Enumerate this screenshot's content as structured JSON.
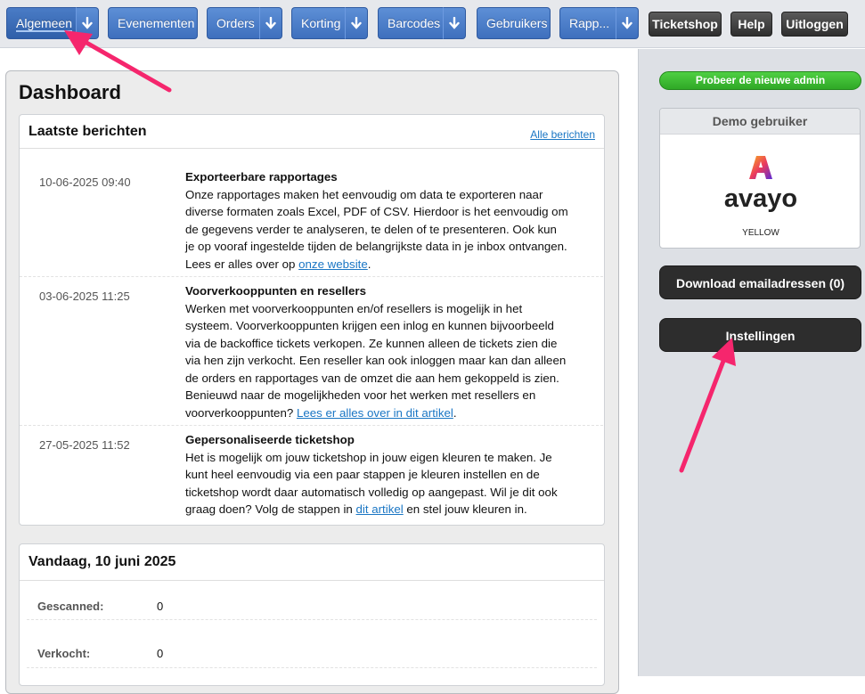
{
  "nav": {
    "items": [
      {
        "label": "Algemeen"
      },
      {
        "label": "Evenementen"
      },
      {
        "label": "Orders"
      },
      {
        "label": "Korting"
      },
      {
        "label": "Barcodes"
      },
      {
        "label": "Gebruikers"
      },
      {
        "label": "Rapp..."
      }
    ],
    "ticketshop": "Ticketshop",
    "help": "Help",
    "logout": "Uitloggen"
  },
  "dashboard": {
    "title": "Dashboard",
    "messages_panel": {
      "title": "Laatste berichten",
      "all_link": "Alle berichten",
      "messages": [
        {
          "date": "10-06-2025 09:40",
          "title": "Exporteerbare rapportages",
          "text": "Onze rapportages maken het eenvoudig om data te exporteren naar diverse formaten zoals Excel, PDF of CSV. Hierdoor is het eenvoudig om de gegevens verder te analyseren, te delen of te presenteren. Ook kun je op vooraf ingestelde tijden de belangrijkste data in je inbox ontvangen. Lees er alles over op ",
          "link": "onze website",
          "after": "."
        },
        {
          "date": "03-06-2025 11:25",
          "title": "Voorverkooppunten en resellers",
          "text": "Werken met voorverkooppunten en/of resellers is mogelijk in het systeem. Voorverkooppunten krijgen een inlog en kunnen bijvoorbeeld via de backoffice tickets verkopen. Ze kunnen alleen de tickets zien die via hen zijn verkocht.  Een reseller kan ook inloggen maar kan dan alleen de orders en rapportages van de omzet die aan hem gekoppeld is zien. Benieuwd naar de mogelijkheden voor het werken met resellers en voorverkooppunten? ",
          "link": "Lees er alles over in dit artikel",
          "after": "."
        },
        {
          "date": "27-05-2025 11:52",
          "title": "Gepersonaliseerde ticketshop",
          "text": "Het is mogelijk om jouw ticketshop in jouw eigen kleuren te maken. Je kunt heel eenvoudig via een paar stappen je kleuren instellen en de ticketshop wordt daar automatisch volledig op aangepast. Wil je dit ook graag doen? Volg de stappen in ",
          "link": "dit artikel",
          "after": " en stel jouw kleuren in."
        }
      ]
    },
    "today_panel": {
      "title": "Vandaag, 10 juni 2025",
      "stats": [
        {
          "label": "Gescanned:",
          "value": "0"
        },
        {
          "label": "Verkocht:",
          "value": "0"
        }
      ]
    }
  },
  "sidebar": {
    "try_new_admin": "Probeer de nieuwe admin",
    "demo_card": {
      "title": "Demo gebruiker",
      "logo_text": "avayo",
      "name": "YELLOW"
    },
    "download_emails": "Download emailadressen (0)",
    "settings": "Instellingen"
  },
  "colors": {
    "nav_blue": "#4a7cc6",
    "dark_button": "#2d2d2d",
    "green_button": "#3cbc30",
    "link": "#1a76c4",
    "annotation_arrow": "#f5266d"
  }
}
